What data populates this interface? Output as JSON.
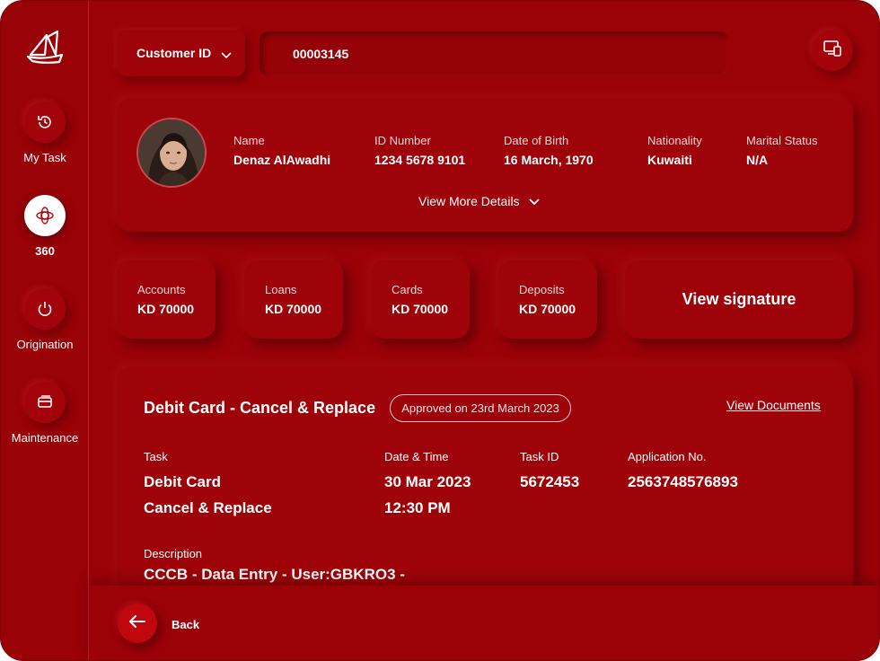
{
  "sidebar": {
    "items": [
      {
        "label": "My Task",
        "icon": "history-icon"
      },
      {
        "label": "360",
        "icon": "360-view-icon",
        "active": true
      },
      {
        "label": "Origination",
        "icon": "power-icon"
      },
      {
        "label": "Maintenance",
        "icon": "card-icon"
      }
    ]
  },
  "search": {
    "select_label": "Customer ID",
    "value": "00003145"
  },
  "profile": {
    "fields": [
      {
        "label": "Name",
        "value": "Denaz AlAwadhi"
      },
      {
        "label": "ID Number",
        "value": "1234 5678 9101"
      },
      {
        "label": "Date of Birth",
        "value": "16 March, 1970"
      },
      {
        "label": "Nationality",
        "value": "Kuwaiti"
      },
      {
        "label": "Marital Status",
        "value": "N/A"
      }
    ],
    "more_label": "View More Details"
  },
  "stats": [
    {
      "label": "Accounts",
      "value": "KD 70000"
    },
    {
      "label": "Loans",
      "value": "KD 70000"
    },
    {
      "label": "Cards",
      "value": "KD 70000"
    },
    {
      "label": "Deposits",
      "value": "KD 70000"
    }
  ],
  "signature_label": "View signature",
  "task": {
    "title": "Debit Card - Cancel & Replace",
    "status_pill": "Approved on 23rd March 2023",
    "documents_link": "View Documents",
    "fields": [
      {
        "label": "Task",
        "line1": "Debit Card",
        "line2": "Cancel & Replace"
      },
      {
        "label": "Date & Time",
        "line1": "30 Mar 2023",
        "line2": "12:30 PM"
      },
      {
        "label": "Task ID",
        "line1": "5672453",
        "line2": ""
      },
      {
        "label": "Application No.",
        "line1": "2563748576893",
        "line2": ""
      }
    ],
    "description_label": "Description",
    "description_value": "CCCB - Data Entry - User:GBKRO3 -"
  },
  "footer": {
    "back_label": "Back"
  },
  "colors": {
    "background": "#9b0208",
    "accent": "#c0060e",
    "text": "#ffffff"
  }
}
